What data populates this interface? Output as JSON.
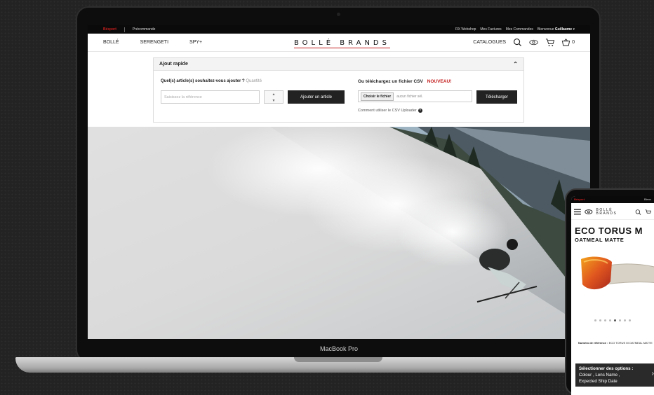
{
  "colors": {
    "accent_red": "#c41e1e",
    "dark": "#222222",
    "background": "#232323"
  },
  "laptop": {
    "model_label": "MacBook Pro"
  },
  "site": {
    "topbar": {
      "brand_small": "Bésport",
      "precommande": "Précommande",
      "links": [
        "RX Webshop",
        "Mes Factures",
        "Mes Commandes"
      ],
      "welcome": "Bienvenue",
      "user": "Guillaume"
    },
    "nav": {
      "brands": [
        "BOLLÉ",
        "SERENGETI",
        "SPY+"
      ],
      "logo": "BOLLÉ BRANDS",
      "catalogues": "CATALOGUES",
      "cart_count": "0",
      "icons": [
        "search-icon",
        "eye-icon",
        "cart-icon",
        "basket-icon"
      ]
    },
    "quick_add": {
      "title": "Ajout rapide",
      "question": "Quel(s) article(s) souhaitez-vous ajouter ?",
      "qty_label": "Quantité",
      "ref_placeholder": "Saisissez la référence",
      "add_button": "Ajouter un article",
      "csv_title": "Ou téléchargez un fichier CSV",
      "csv_new": "NOUVEAU!",
      "choose_file": "Choisir le fichier",
      "no_file": "aucun fichier sél.",
      "upload_button": "Télécharger",
      "csv_help": "Comment utiliser le CSV Uploader"
    }
  },
  "phone": {
    "topbar_brand": "Bésport",
    "topbar_right": "Bienv",
    "product_title": "ECO TORUS M",
    "product_subtitle": "OATMEAL MATTE",
    "ref_label": "Numéro de référence :",
    "ref_value": "ECO TORUS M OATMEAL MATTE",
    "options_title": "Sélectionner des options :",
    "options_line1": "Colour , Lens Name ,",
    "options_line2": "Expected Ship Date",
    "carousel_active": 4,
    "carousel_total": 8
  }
}
